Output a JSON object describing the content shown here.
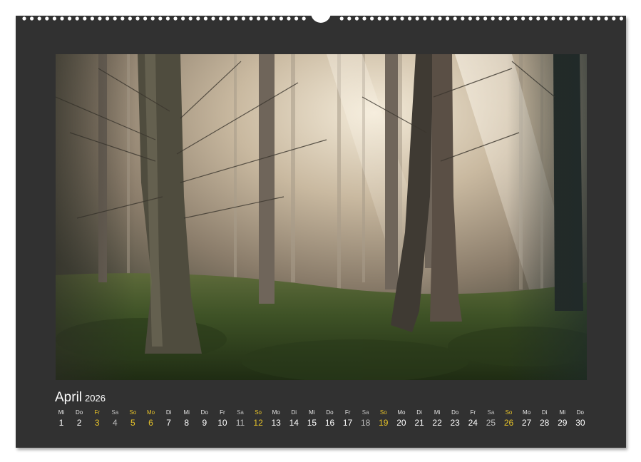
{
  "calendar": {
    "month": "April",
    "year": "2026",
    "days": [
      {
        "name": "Mi",
        "num": "1",
        "type": "normal"
      },
      {
        "name": "Do",
        "num": "2",
        "type": "normal"
      },
      {
        "name": "Fr",
        "num": "3",
        "type": "holiday"
      },
      {
        "name": "Sa",
        "num": "4",
        "type": "saturday"
      },
      {
        "name": "So",
        "num": "5",
        "type": "holiday"
      },
      {
        "name": "Mo",
        "num": "6",
        "type": "holiday"
      },
      {
        "name": "Di",
        "num": "7",
        "type": "normal"
      },
      {
        "name": "Mi",
        "num": "8",
        "type": "normal"
      },
      {
        "name": "Do",
        "num": "9",
        "type": "normal"
      },
      {
        "name": "Fr",
        "num": "10",
        "type": "normal"
      },
      {
        "name": "Sa",
        "num": "11",
        "type": "saturday"
      },
      {
        "name": "So",
        "num": "12",
        "type": "holiday"
      },
      {
        "name": "Mo",
        "num": "13",
        "type": "normal"
      },
      {
        "name": "Di",
        "num": "14",
        "type": "normal"
      },
      {
        "name": "Mi",
        "num": "15",
        "type": "normal"
      },
      {
        "name": "Do",
        "num": "16",
        "type": "normal"
      },
      {
        "name": "Fr",
        "num": "17",
        "type": "normal"
      },
      {
        "name": "Sa",
        "num": "18",
        "type": "saturday"
      },
      {
        "name": "So",
        "num": "19",
        "type": "holiday"
      },
      {
        "name": "Mo",
        "num": "20",
        "type": "normal"
      },
      {
        "name": "Di",
        "num": "21",
        "type": "normal"
      },
      {
        "name": "Mi",
        "num": "22",
        "type": "normal"
      },
      {
        "name": "Do",
        "num": "23",
        "type": "normal"
      },
      {
        "name": "Fr",
        "num": "24",
        "type": "normal"
      },
      {
        "name": "Sa",
        "num": "25",
        "type": "saturday"
      },
      {
        "name": "So",
        "num": "26",
        "type": "holiday"
      },
      {
        "name": "Mo",
        "num": "27",
        "type": "normal"
      },
      {
        "name": "Di",
        "num": "28",
        "type": "normal"
      },
      {
        "name": "Mi",
        "num": "29",
        "type": "normal"
      },
      {
        "name": "Do",
        "num": "30",
        "type": "normal"
      }
    ]
  },
  "colors": {
    "page": "#313131",
    "holiday": "#e6c229",
    "saturday": "#bdbdbd",
    "text": "#ffffff"
  },
  "photo": {
    "subject": "misty-forest-with-sunbeams"
  }
}
